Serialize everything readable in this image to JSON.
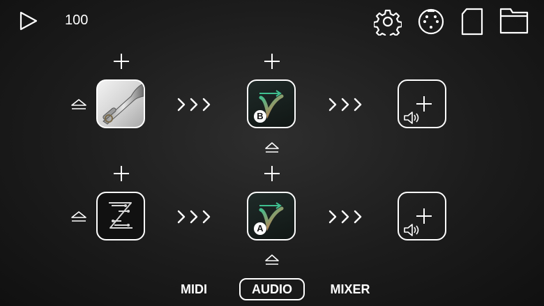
{
  "toolbar": {
    "tempo": "100",
    "play_icon": "play-icon",
    "settings_icon": "gear-icon",
    "midi_icon": "midi-connector-icon",
    "file_icon": "document-icon",
    "folder_icon": "folder-icon"
  },
  "chains": [
    {
      "instrument": "trumpet",
      "effect_badge": "B",
      "output": "add-audio-output"
    },
    {
      "instrument": "z-effect",
      "effect_badge": "A",
      "output": "add-audio-output"
    }
  ],
  "tabs": [
    {
      "label": "MIDI",
      "active": false
    },
    {
      "label": "AUDIO",
      "active": true
    },
    {
      "label": "MIXER",
      "active": false
    }
  ],
  "colors": {
    "background": "#1c1c1c",
    "foreground": "#ffffff",
    "effect_accent": "#3fbf8f"
  }
}
